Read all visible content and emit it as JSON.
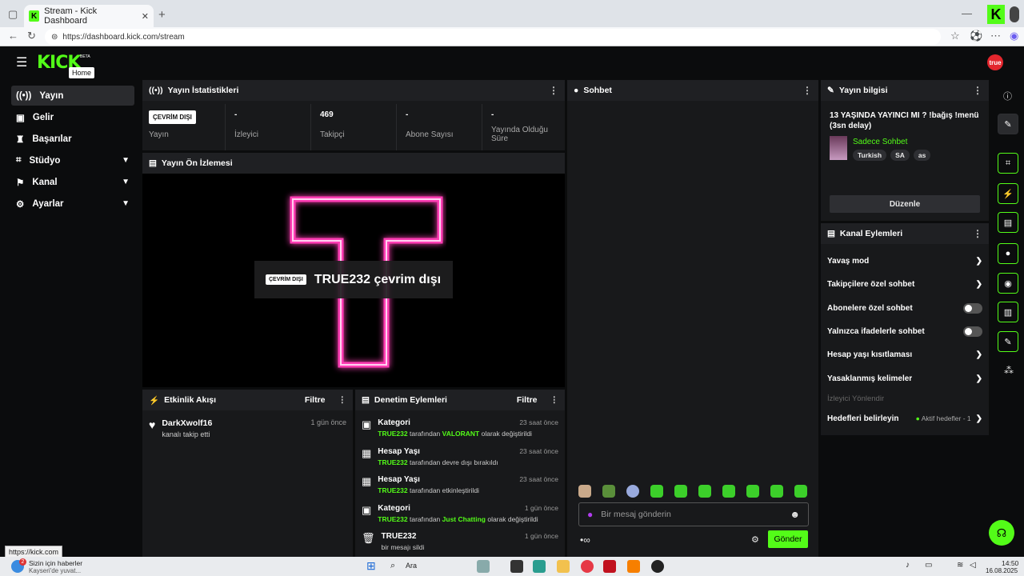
{
  "browser": {
    "tab_title": "Stream - Kick Dashboard",
    "url": "https://dashboard.kick.com/stream"
  },
  "app": {
    "logo": "KICK",
    "logo_badge": "BETA",
    "tooltip": "Home",
    "avatar_text": "true",
    "status_url": "https://kick.com"
  },
  "sidebar": {
    "items": [
      {
        "label": "Yayın",
        "icon": "broadcast-icon"
      },
      {
        "label": "Gelir",
        "icon": "wallet-icon"
      },
      {
        "label": "Başarılar",
        "icon": "trophy-icon"
      },
      {
        "label": "Stüdyo",
        "icon": "studio-icon"
      },
      {
        "label": "Kanal",
        "icon": "channel-icon"
      },
      {
        "label": "Ayarlar",
        "icon": "gear-icon"
      }
    ]
  },
  "stats": {
    "title": "Yayın İstatistikleri",
    "cells": [
      {
        "value": "ÇEVRİM DIŞI",
        "label": "Yayın"
      },
      {
        "value": "-",
        "label": "İzleyici"
      },
      {
        "value": "469",
        "label": "Takipçi"
      },
      {
        "value": "-",
        "label": "Abone Sayısı"
      },
      {
        "value": "-",
        "label": "Yayında Olduğu Süre"
      }
    ]
  },
  "preview": {
    "title": "Yayın Ön İzlemesi",
    "badge": "ÇEVRİM DIŞI",
    "text": "TRUE232 çevrim dışı"
  },
  "activity": {
    "title": "Etkinlik Akışı",
    "filter": "Filtre",
    "items": [
      {
        "name": "DarkXwolf16",
        "desc": "kanalı takip etti",
        "time": "1 gün önce"
      }
    ]
  },
  "moderation": {
    "title": "Denetim Eylemleri",
    "filter": "Filtre",
    "items": [
      {
        "title": "Kategori",
        "user": "TRUE232",
        "mid": "tarafından",
        "value": "VALORANT",
        "rest": "olarak değiştirildi",
        "time": "23 saat önce"
      },
      {
        "title": "Hesap Yaşı",
        "user": "TRUE232",
        "mid": "tarafından devre dışı bırakıldı",
        "value": "",
        "rest": "",
        "time": "23 saat önce"
      },
      {
        "title": "Hesap Yaşı",
        "user": "TRUE232",
        "mid": "tarafından etkinleştirildi",
        "value": "",
        "rest": "",
        "time": "23 saat önce"
      },
      {
        "title": "Kategori",
        "user": "TRUE232",
        "mid": "tarafından",
        "value": "Just Chatting",
        "rest": "olarak değiştirildi",
        "time": "1 gün önce"
      },
      {
        "title": "TRUE232",
        "user": "",
        "mid": "bir mesajı sildi",
        "value": "",
        "rest": "",
        "time": "1 gün önce"
      }
    ]
  },
  "chat": {
    "title": "Sohbet",
    "placeholder": "Bir mesaj gönderin",
    "send": "Gönder"
  },
  "info": {
    "title": "Yayın bilgisi",
    "stream_title": "13 YAŞINDA YAYINCI MI ? !bağış !menü (3sn delay)",
    "category": "Sadece Sohbet",
    "tags": [
      "Turkish",
      "SA",
      "as"
    ],
    "edit": "Düzenle"
  },
  "channel_actions": {
    "title": "Kanal Eylemleri",
    "rows": [
      {
        "label": "Yavaş mod",
        "type": "chevron"
      },
      {
        "label": "Takipçilere özel sohbet",
        "type": "chevron"
      },
      {
        "label": "Abonelere özel sohbet",
        "type": "toggle"
      },
      {
        "label": "Yalnızca ifadelerle sohbet",
        "type": "toggle"
      },
      {
        "label": "Hesap yaşı kısıtlaması",
        "type": "chevron"
      },
      {
        "label": "Yasaklanmış kelimeler",
        "type": "chevron"
      }
    ],
    "section": "İzleyici Yönlendir",
    "goals_label": "Hedefleri belirleyin",
    "goals_status": "Aktif hedefler - 1"
  },
  "taskbar": {
    "news_title": "Sizin için haberler",
    "news_sub": "Kayseri'de yuvat...",
    "search": "Ara",
    "time": "14:50",
    "date": "16.08.2025",
    "notif_count": "2"
  },
  "colors": {
    "accent": "#53fc18",
    "bg": "#0b0c0d",
    "panel": "#18191b"
  }
}
